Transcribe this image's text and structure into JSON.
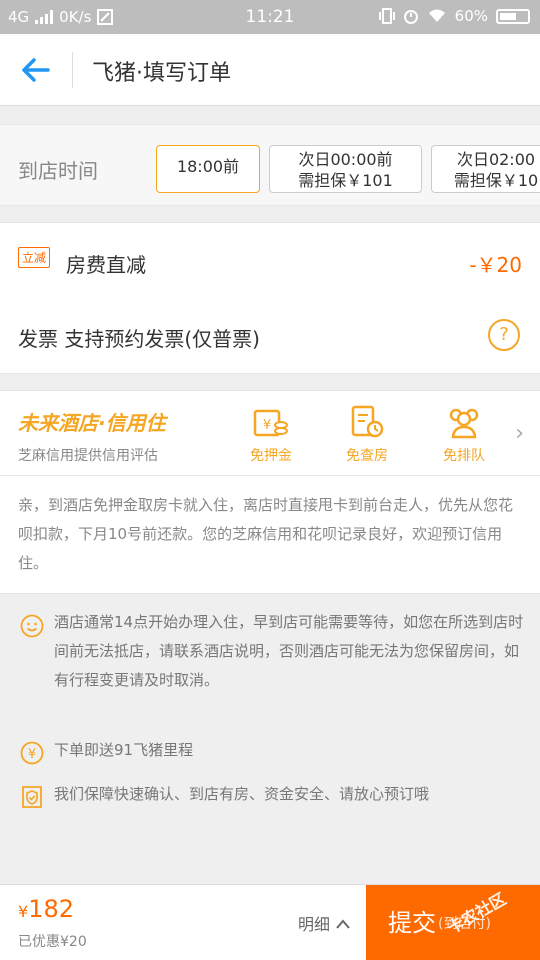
{
  "status_bar": {
    "network": "4G",
    "speed": "0K/s",
    "time": "11:21",
    "battery": "60%"
  },
  "nav": {
    "title": "飞猪·填写订单"
  },
  "arrive": {
    "label": "到店时间",
    "options": [
      {
        "line1": "18:00前",
        "line2": ""
      },
      {
        "line1": "次日00:00前",
        "line2": "需担保￥101"
      },
      {
        "line1": "次日02:00",
        "line2": "需担保￥10"
      }
    ]
  },
  "discount": {
    "tag": "立减",
    "label": "房费直减",
    "amount": "-￥20",
    "invoice": "发票 支持预约发票(仅普票)"
  },
  "credit": {
    "title": "未来酒店·信用住",
    "subtitle": "芝麻信用提供信用评估",
    "perks": [
      "免押金",
      "免查房",
      "免排队"
    ],
    "description": "亲，到酒店免押金取房卡就入住，离店时直接甩卡到前台走人，优先从您花呗扣款，下月10号前还款。您的芝麻信用和花呗记录良好，欢迎预订信用住。"
  },
  "tips": [
    {
      "icon": "smile-icon",
      "text": "酒店通常14点开始办理入住，早到店可能需要等待，如您在所选到店时间前无法抵店，请联系酒店说明，否则酒店可能无法为您保留房间，如有行程变更请及时取消。"
    },
    {
      "icon": "yen-icon",
      "text": "下单即送91飞猪里程"
    },
    {
      "icon": "shield-icon",
      "text": "我们保障快速确认、到店有房、资金安全、请放心预订哦"
    }
  ],
  "bottom": {
    "currency": "¥",
    "price": "182",
    "saved": "已优惠¥20",
    "detail": "明细",
    "submit": "提交",
    "submit_sub": "(到店付)"
  },
  "watermark": "卡农社区",
  "colors": {
    "accent": "#f5a623",
    "orange": "#ff6a00",
    "back_arrow": "#2196f3"
  }
}
